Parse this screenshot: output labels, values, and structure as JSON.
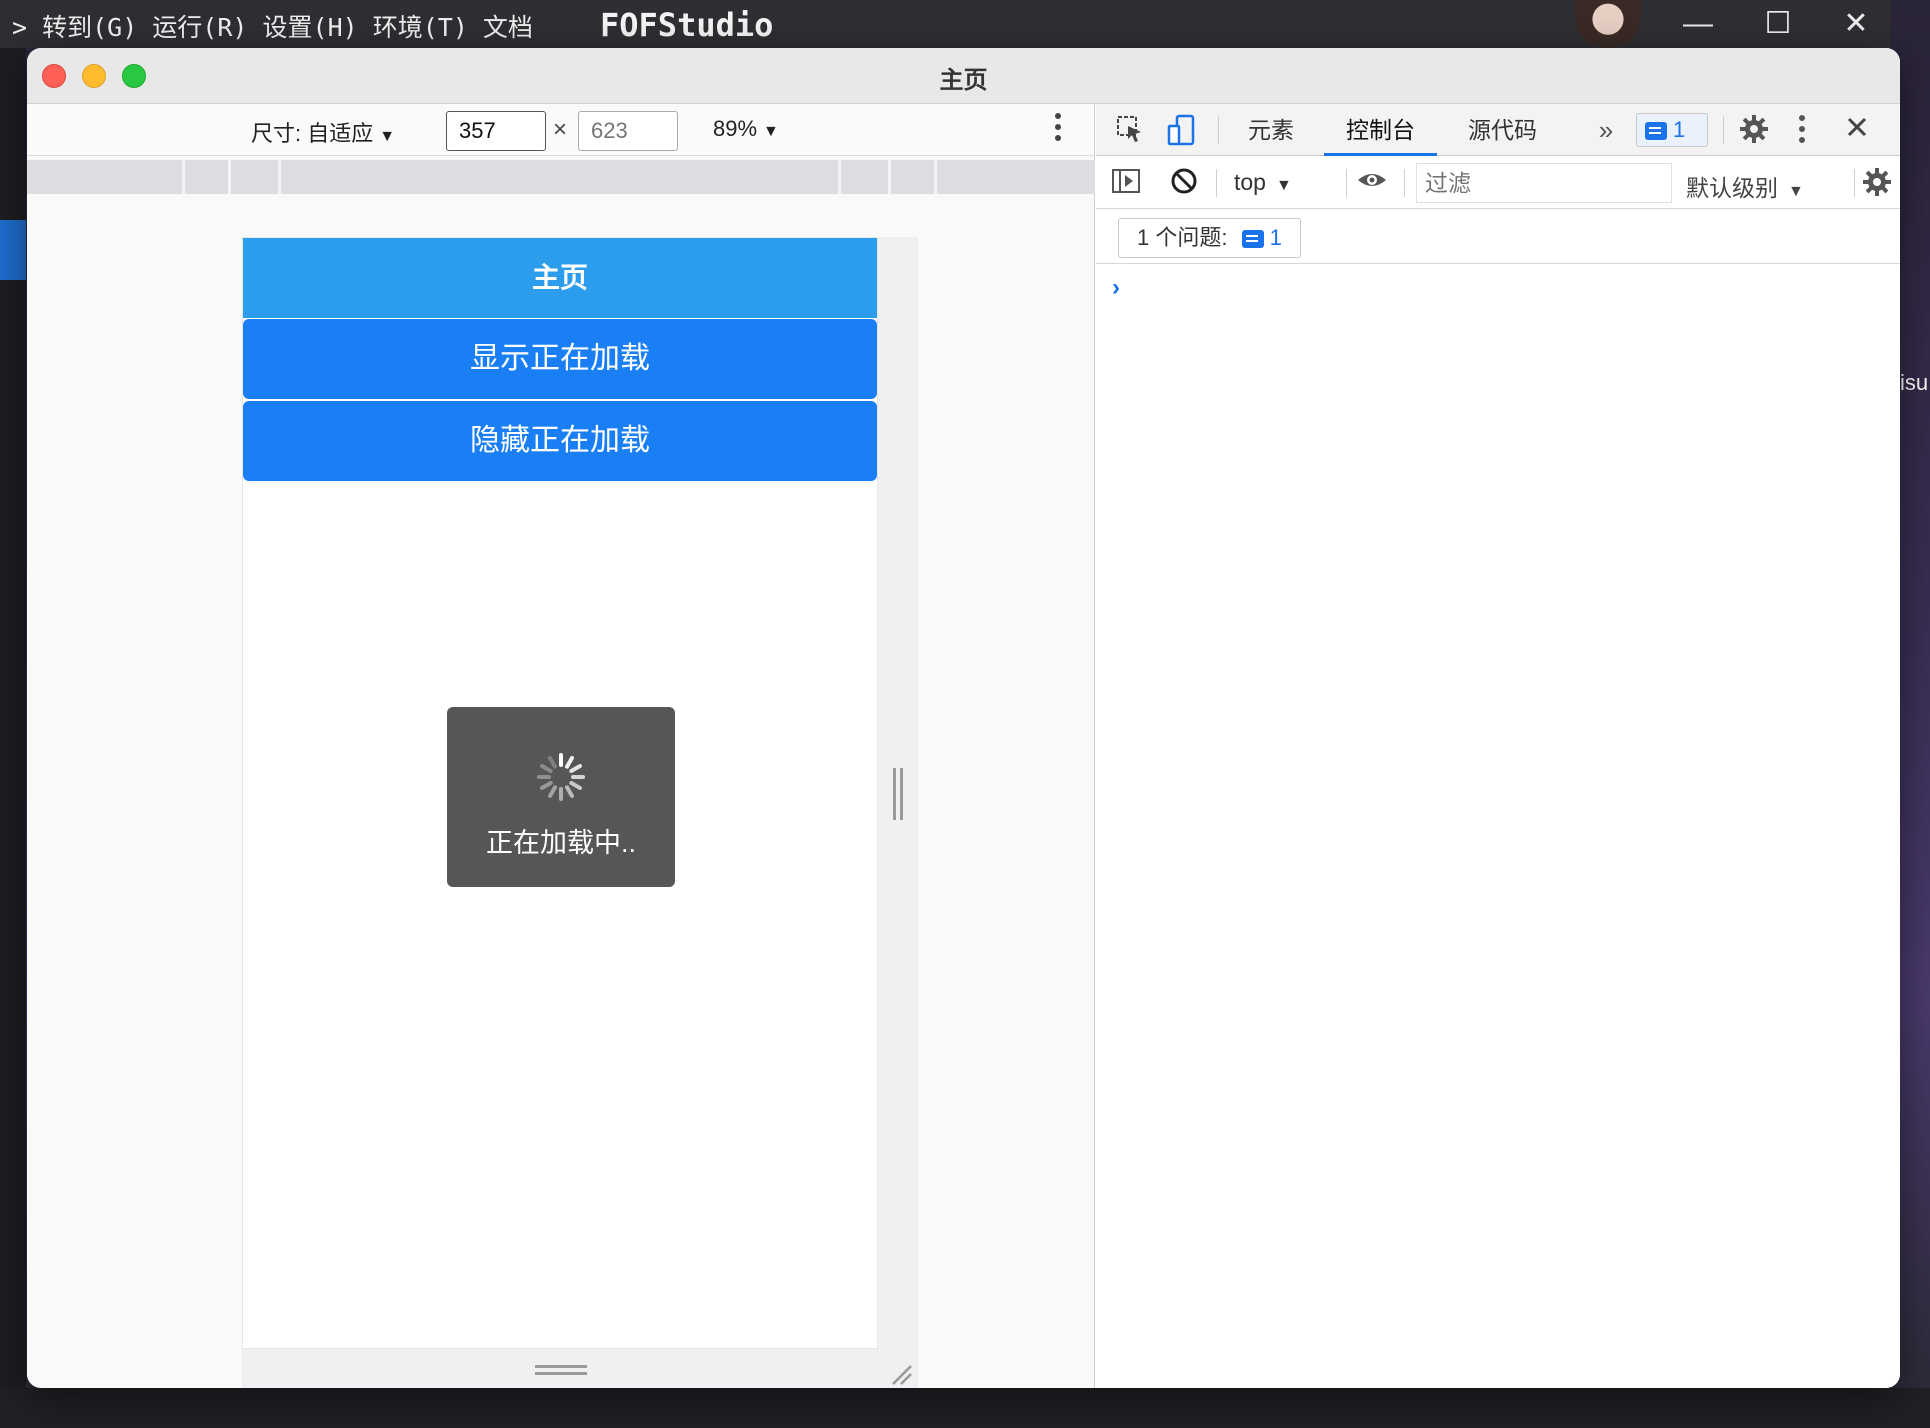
{
  "background": {
    "menu_text": "> 转到(G) 运行(R) 设置(H) 环境(T) 文档",
    "app_name": "FOFStudio",
    "right_edge_text": "isu",
    "window_buttons": {
      "minimize": "—",
      "maximize": "☐",
      "close": "✕"
    }
  },
  "window": {
    "title": "主页"
  },
  "device_toolbar": {
    "size_label": "尺寸: 自适应",
    "width_value": "357",
    "height_placeholder": "623",
    "times": "×",
    "zoom": "89%",
    "more": "⋮"
  },
  "phone": {
    "header_title": "主页",
    "show_loading_button": "显示正在加载",
    "hide_loading_button": "隐藏正在加载",
    "toast_text": "正在加载中.."
  },
  "devtools": {
    "tabs": [
      {
        "label": "元素"
      },
      {
        "label": "控制台"
      },
      {
        "label": "源代码"
      }
    ],
    "more_tabs": "»",
    "issues_badge_count": "1",
    "context": "top",
    "filter_placeholder": "过滤",
    "level": "默认级别",
    "issues_label": "1 个问题:",
    "issues_count": "1",
    "prompt": "›"
  },
  "colors": {
    "header_blue": "#2c9cec",
    "button_blue": "#1a7ff5",
    "toast_bg": "#565656",
    "devtools_accent": "#1a73e8"
  }
}
